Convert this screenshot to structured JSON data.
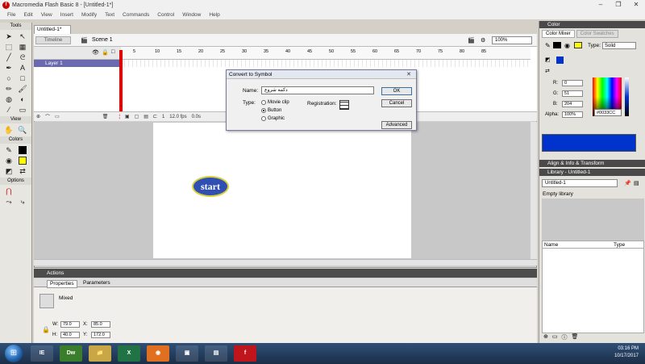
{
  "window": {
    "title": "Macromedia Flash Basic 8 - [Untitled-1*]",
    "controls": [
      "–",
      "❐",
      "✕"
    ]
  },
  "menu": [
    "File",
    "Edit",
    "View",
    "Insert",
    "Modify",
    "Text",
    "Commands",
    "Control",
    "Window",
    "Help"
  ],
  "tools_panel": {
    "title": "Tools",
    "view_title": "View",
    "colors_title": "Colors",
    "options_title": "Options"
  },
  "document": {
    "tab": "Untitled-1*",
    "timeline_button": "Timeline",
    "scene": "Scene 1",
    "zoom": "100%"
  },
  "timeline": {
    "layer_name": "Layer 1",
    "frame_ticks": [
      "5",
      "10",
      "15",
      "20",
      "25",
      "30",
      "35",
      "40",
      "45",
      "50",
      "55",
      "60",
      "65",
      "70",
      "75",
      "80",
      "85"
    ],
    "current_frame": "1",
    "fps": "12.0 fps",
    "elapsed": "0.0s"
  },
  "stage": {
    "button_text": "start"
  },
  "dialog": {
    "title": "Convert to Symbol",
    "name_label": "Name:",
    "name_value": "دکمه شروع",
    "type_label": "Type:",
    "types": [
      "Movie clip",
      "Button",
      "Graphic"
    ],
    "selected_type": "Button",
    "registration_label": "Registration:",
    "ok": "OK",
    "cancel": "Cancel",
    "advanced": "Advanced"
  },
  "color_panel": {
    "header": "Color",
    "tab_mixer": "Color Mixer",
    "tab_swatches": "Color Swatches",
    "type_label": "Type:",
    "type_value": "Solid",
    "r_label": "R:",
    "r": "0",
    "g_label": "G:",
    "g": "51",
    "b_label": "B:",
    "b": "204",
    "alpha_label": "Alpha:",
    "alpha": "100%",
    "hex": "#0033CC",
    "swatch_color": "#0033cc"
  },
  "align_panel": {
    "header": "Align & Info & Transform"
  },
  "library_panel": {
    "header": "Library - Untitled-1",
    "doc": "Untitled-1",
    "empty": "Empty library",
    "col_name": "Name",
    "col_type": "Type"
  },
  "actions_panel": {
    "header": "Actions"
  },
  "properties": {
    "tab_properties": "Properties",
    "tab_parameters": "Parameters",
    "mixed": "Mixed",
    "w_label": "W:",
    "w": "79.0",
    "x_label": "X:",
    "x": "85.0",
    "h_label": "H:",
    "h": "40.0",
    "y_label": "Y:",
    "y": "172.0"
  },
  "taskbar": {
    "apps": [
      "IE",
      "Dw",
      "📁",
      "X",
      "◉",
      "▣",
      "▤",
      "f"
    ],
    "time": "03:16 PM",
    "date": "10/17/2017"
  }
}
